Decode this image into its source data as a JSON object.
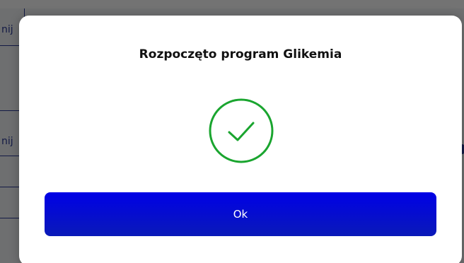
{
  "background": {
    "row_fragments": [
      "nij",
      "nij"
    ]
  },
  "modal": {
    "title": "Rozpoczęto program Glikemia",
    "icon": "check-circle-icon",
    "icon_color": "#1aa52f",
    "ok_label": "Ok",
    "button_color": "#0000e6"
  }
}
